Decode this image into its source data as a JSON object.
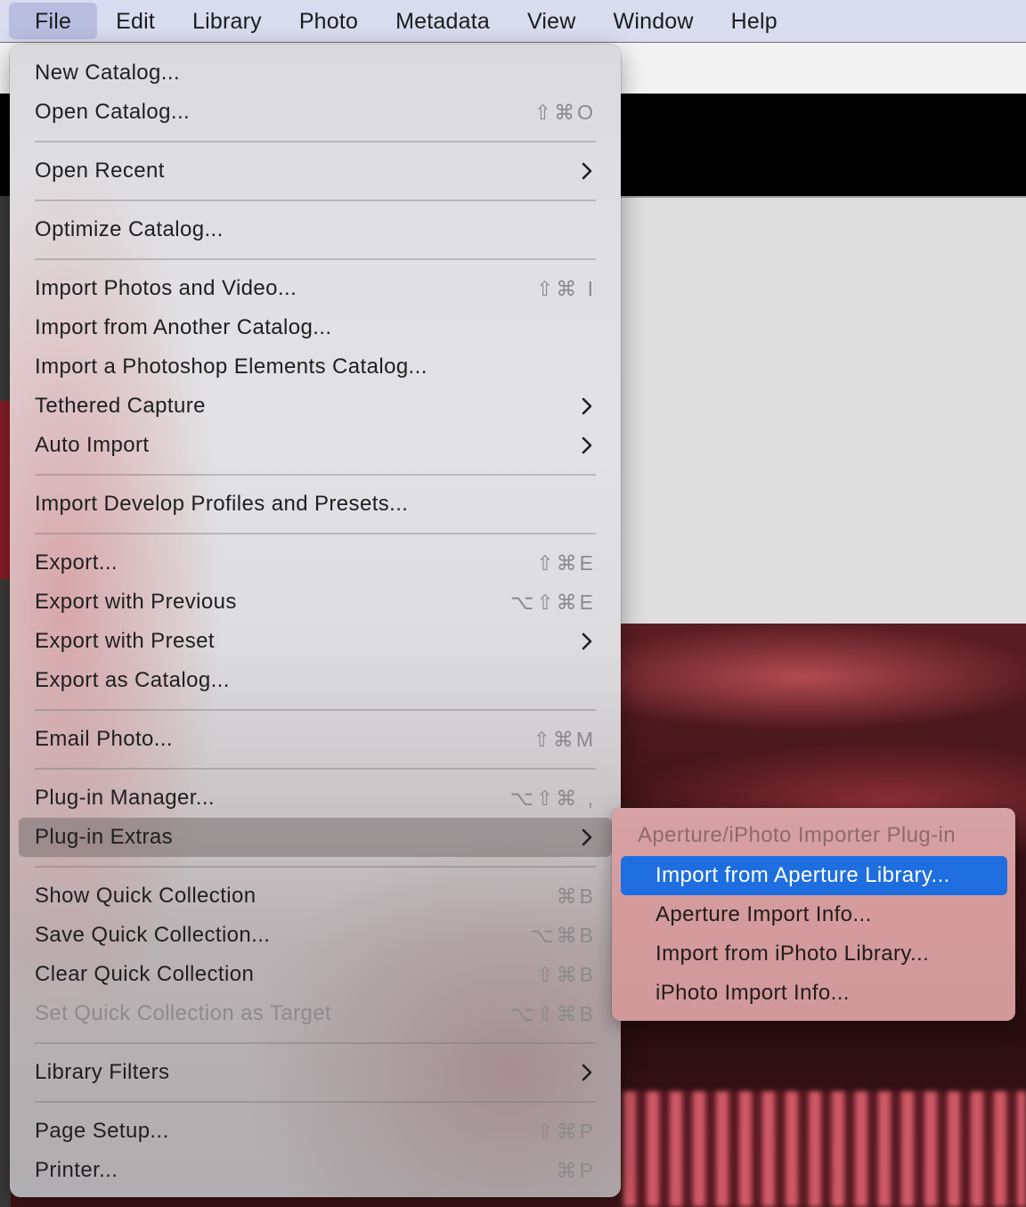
{
  "menubar": {
    "items": [
      "File",
      "Edit",
      "Library",
      "Photo",
      "Metadata",
      "View",
      "Window",
      "Help"
    ],
    "active": "File"
  },
  "file_menu": {
    "new_catalog": "New Catalog...",
    "open_catalog": "Open Catalog...",
    "open_catalog_sc": "⇧⌘O",
    "open_recent": "Open Recent",
    "optimize_catalog": "Optimize Catalog...",
    "import_photos": "Import Photos and Video...",
    "import_photos_sc": "⇧⌘ I",
    "import_another": "Import from Another Catalog...",
    "import_pse": "Import a Photoshop Elements Catalog...",
    "tethered_capture": "Tethered Capture",
    "auto_import": "Auto Import",
    "import_profiles": "Import Develop Profiles and Presets...",
    "export": "Export...",
    "export_sc": "⇧⌘E",
    "export_previous": "Export with Previous",
    "export_previous_sc": "⌥⇧⌘E",
    "export_preset": "Export with Preset",
    "export_catalog": "Export as Catalog...",
    "email_photo": "Email Photo...",
    "email_photo_sc": "⇧⌘M",
    "plugin_manager": "Plug-in Manager...",
    "plugin_manager_sc": "⌥⇧⌘ ,",
    "plugin_extras": "Plug-in Extras",
    "show_quick": "Show Quick Collection",
    "show_quick_sc": "⌘B",
    "save_quick": "Save Quick Collection...",
    "save_quick_sc": "⌥⌘B",
    "clear_quick": "Clear Quick Collection",
    "clear_quick_sc": "⇧⌘B",
    "set_quick_target": "Set Quick Collection as Target",
    "set_quick_target_sc": "⌥⇧⌘B",
    "library_filters": "Library Filters",
    "page_setup": "Page Setup...",
    "page_setup_sc": "⇧⌘P",
    "printer": "Printer...",
    "printer_sc": "⌘P"
  },
  "submenu": {
    "header": "Aperture/iPhoto Importer Plug-in",
    "items": [
      "Import from Aperture Library...",
      "Aperture Import Info...",
      "Import from iPhoto Library...",
      "iPhoto Import Info..."
    ],
    "selected": "Import from Aperture Library..."
  },
  "colors": {
    "selection": "#1f6ee0",
    "menubar": "#d9dcef"
  }
}
